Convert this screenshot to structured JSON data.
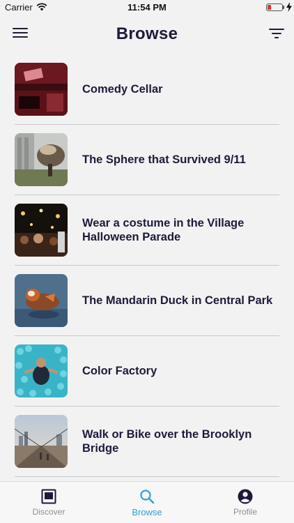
{
  "status_bar": {
    "carrier": "Carrier",
    "time": "11:54 PM",
    "battery_color": "#e0332e",
    "icons": [
      "wifi-icon",
      "battery-icon",
      "charging-bolt-icon"
    ]
  },
  "header": {
    "title": "Browse",
    "icons": [
      "hamburger-menu-icon",
      "filter-icon"
    ]
  },
  "items": [
    {
      "label": "Comedy Cellar",
      "image": "red-lit bar interior"
    },
    {
      "label": "The Sphere that Survived 9/11",
      "image": "damaged bronze sphere sculpture"
    },
    {
      "label": "Wear a costume in the Village Halloween Parade",
      "image": "night parade crowd"
    },
    {
      "label": "The Mandarin Duck in Central Park",
      "image": "mandarin duck on water"
    },
    {
      "label": "Color Factory",
      "image": "person in blue ball pit"
    },
    {
      "label": "Walk or Bike over the Brooklyn Bridge",
      "image": "brooklyn bridge walkway"
    }
  ],
  "tabs": [
    {
      "label": "Discover",
      "icon": "discover-icon",
      "active": false
    },
    {
      "label": "Browse",
      "icon": "search-icon",
      "active": true
    },
    {
      "label": "Profile",
      "icon": "profile-icon",
      "active": false
    }
  ],
  "colors": {
    "accent": "#2f9fd8",
    "title": "#1c1b3a",
    "background": "#f2f2f2",
    "inactive_tab": "#8e8e93"
  }
}
